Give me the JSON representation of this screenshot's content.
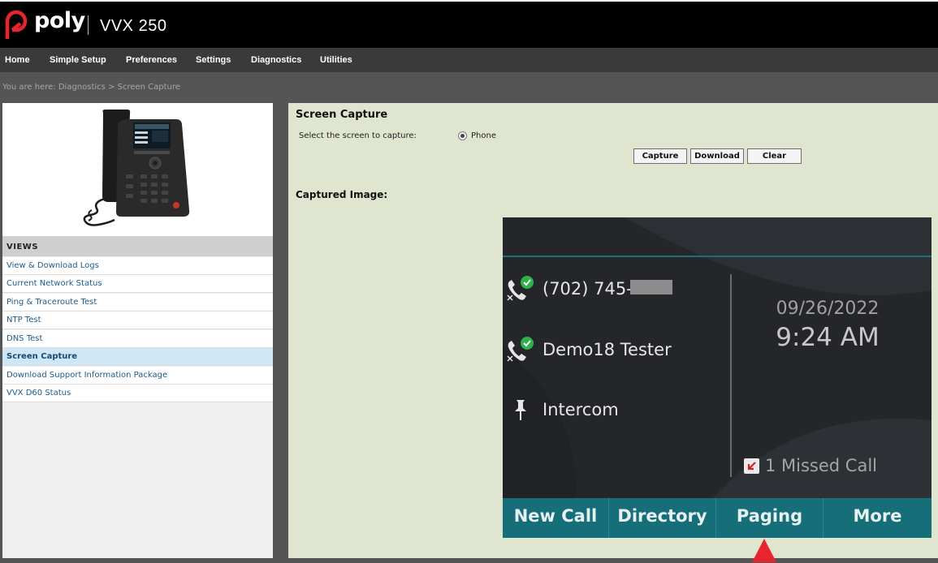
{
  "app": {
    "brand": "poly",
    "model": "VVX 250"
  },
  "nav": {
    "items": [
      "Home",
      "Simple Setup",
      "Preferences",
      "Settings",
      "Diagnostics",
      "Utilities"
    ]
  },
  "breadcrumb": "You are here: Diagnostics > Screen Capture",
  "sidebar": {
    "views_title": "VIEWS",
    "items": [
      "View & Download Logs",
      "Current Network Status",
      "Ping & Traceroute Test",
      "NTP Test",
      "DNS Test",
      "Screen Capture",
      "Download Support Information Package",
      "VVX D60 Status"
    ],
    "active_item": "Screen Capture"
  },
  "main": {
    "title": "Screen Capture",
    "select_label": "Select the screen to capture:",
    "radio_option": "Phone",
    "radio_selected": true,
    "buttons": {
      "capture": "Capture",
      "download": "Download",
      "clear": "Clear"
    },
    "captured_title": "Captured Image:"
  },
  "phone_screen": {
    "lines": [
      {
        "label": "(702) 745-",
        "icon": "registered-line-icon"
      },
      {
        "label": "Demo18 Tester",
        "icon": "registered-line-icon"
      },
      {
        "label": "Intercom",
        "icon": "pushpin-icon"
      }
    ],
    "date": "09/26/2022",
    "time": "9:24 AM",
    "missed_calls": "1 Missed Call",
    "softkeys": [
      "New Call",
      "Directory",
      "Paging",
      "More"
    ]
  },
  "colors": {
    "header_bg": "#000000",
    "nav_bg": "#3a3a3a",
    "content_bg": "#dfe5ce",
    "softkey_bg": "#166e78",
    "accent_red": "#e8252f",
    "link_blue": "#1f5a8a"
  }
}
